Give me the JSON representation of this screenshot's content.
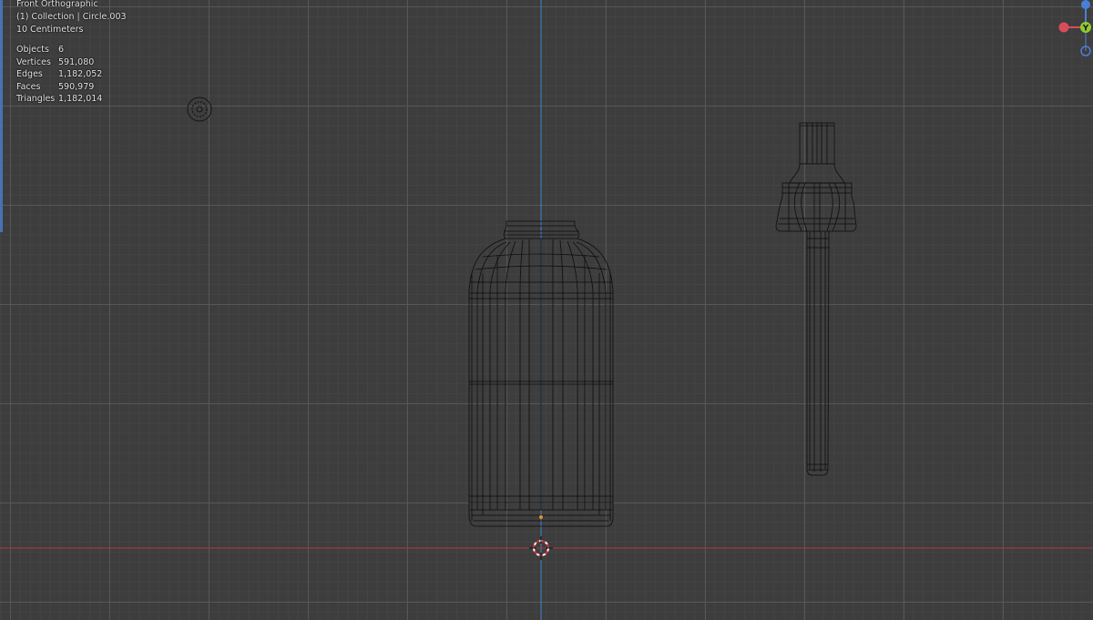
{
  "header": {
    "view_name": "Front Orthographic",
    "collection_info": "(1) Collection | Circle.003",
    "scale_info": "10 Centimeters"
  },
  "statistics": [
    {
      "label": "Objects",
      "value": "6"
    },
    {
      "label": "Vertices",
      "value": "591,080"
    },
    {
      "label": "Edges",
      "value": "1,182,052"
    },
    {
      "label": "Faces",
      "value": "590,979"
    },
    {
      "label": "Triangles",
      "value": "1,182,014"
    }
  ],
  "gizmo": {
    "axes": [
      {
        "name": "X",
        "color": "#d94c5a"
      },
      {
        "name": "Y",
        "color": "#8fcc2e",
        "label": "Y"
      },
      {
        "name": "Z",
        "color": "#4a7fd6"
      }
    ]
  },
  "colors": {
    "grid_background": "#3d3d3d",
    "x_axis_line": "#a03a3a",
    "z_axis_line": "#3f77b8",
    "wireframe": "#0d0d0d",
    "origin_point": "#f28c1a"
  },
  "icons": [
    "3d-cursor-icon",
    "light-object-icon",
    "navigation-gizmo-icon"
  ]
}
